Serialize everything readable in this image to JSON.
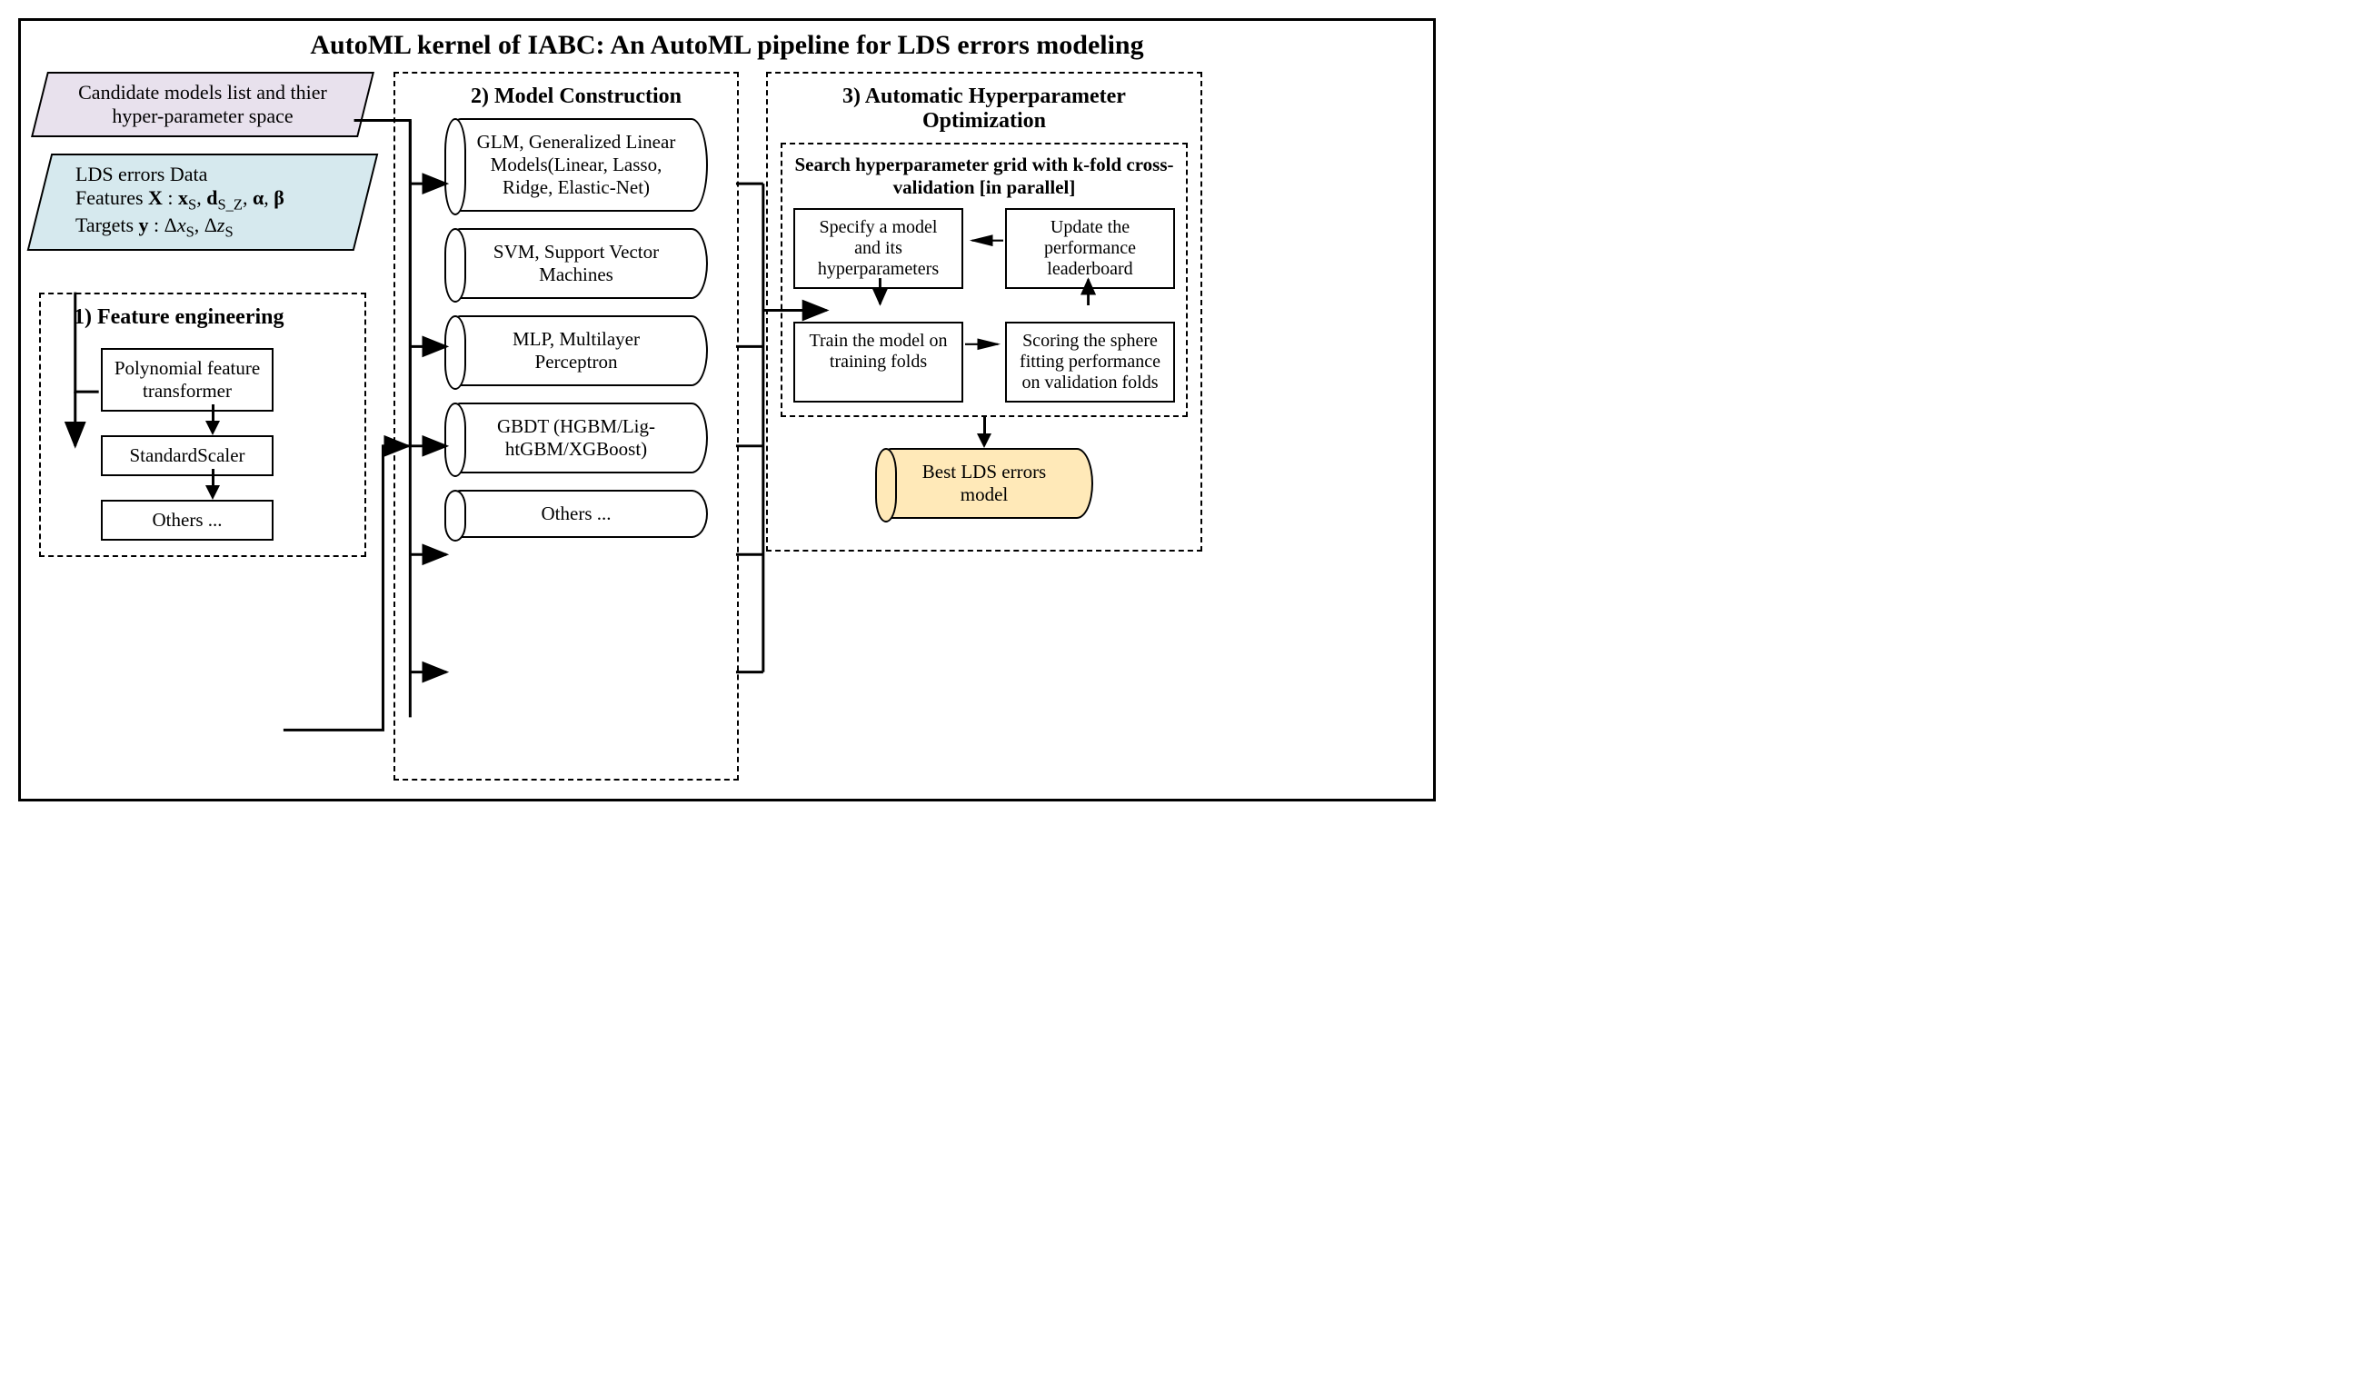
{
  "title": "AutoML kernel of IABC: An AutoML  pipeline for LDS  errors modeling",
  "inputs": {
    "candidate": "Candidate models list and thier hyper-parameter space",
    "lds_line1": "LDS errors Data",
    "lds_features_prefix": "Features ",
    "lds_features_math": "X : xS, dS_Z, α, β",
    "lds_targets_prefix": "Targets ",
    "lds_targets_math": "y : ΔxS, ΔzS"
  },
  "stage1": {
    "title": "1)  Feature engineering",
    "boxes": [
      "Polynomial feature transformer",
      "StandardScaler",
      "Others ..."
    ]
  },
  "stage2": {
    "title": "2) Model Construction",
    "models": [
      "GLM, Generalized Linear Models(Linear, Lasso, Ridge, Elastic-Net)",
      "SVM, Support Vector Machines",
      "MLP, Multilayer Perceptron",
      "GBDT (HGBM/Lig-htGBM/XGBoost)",
      "Others ..."
    ]
  },
  "stage3": {
    "title": "3) Automatic Hyperparameter Optimization",
    "subtitle": "Search hyperparameter grid with k-fold cross-validation [in parallel]",
    "steps": {
      "specify": "Specify a model and its hyperparameters",
      "update": "Update the performance leaderboard",
      "train": "Train the model on training folds",
      "score": "Scoring the sphere fitting performance on validation folds"
    },
    "output": "Best LDS errors model"
  }
}
